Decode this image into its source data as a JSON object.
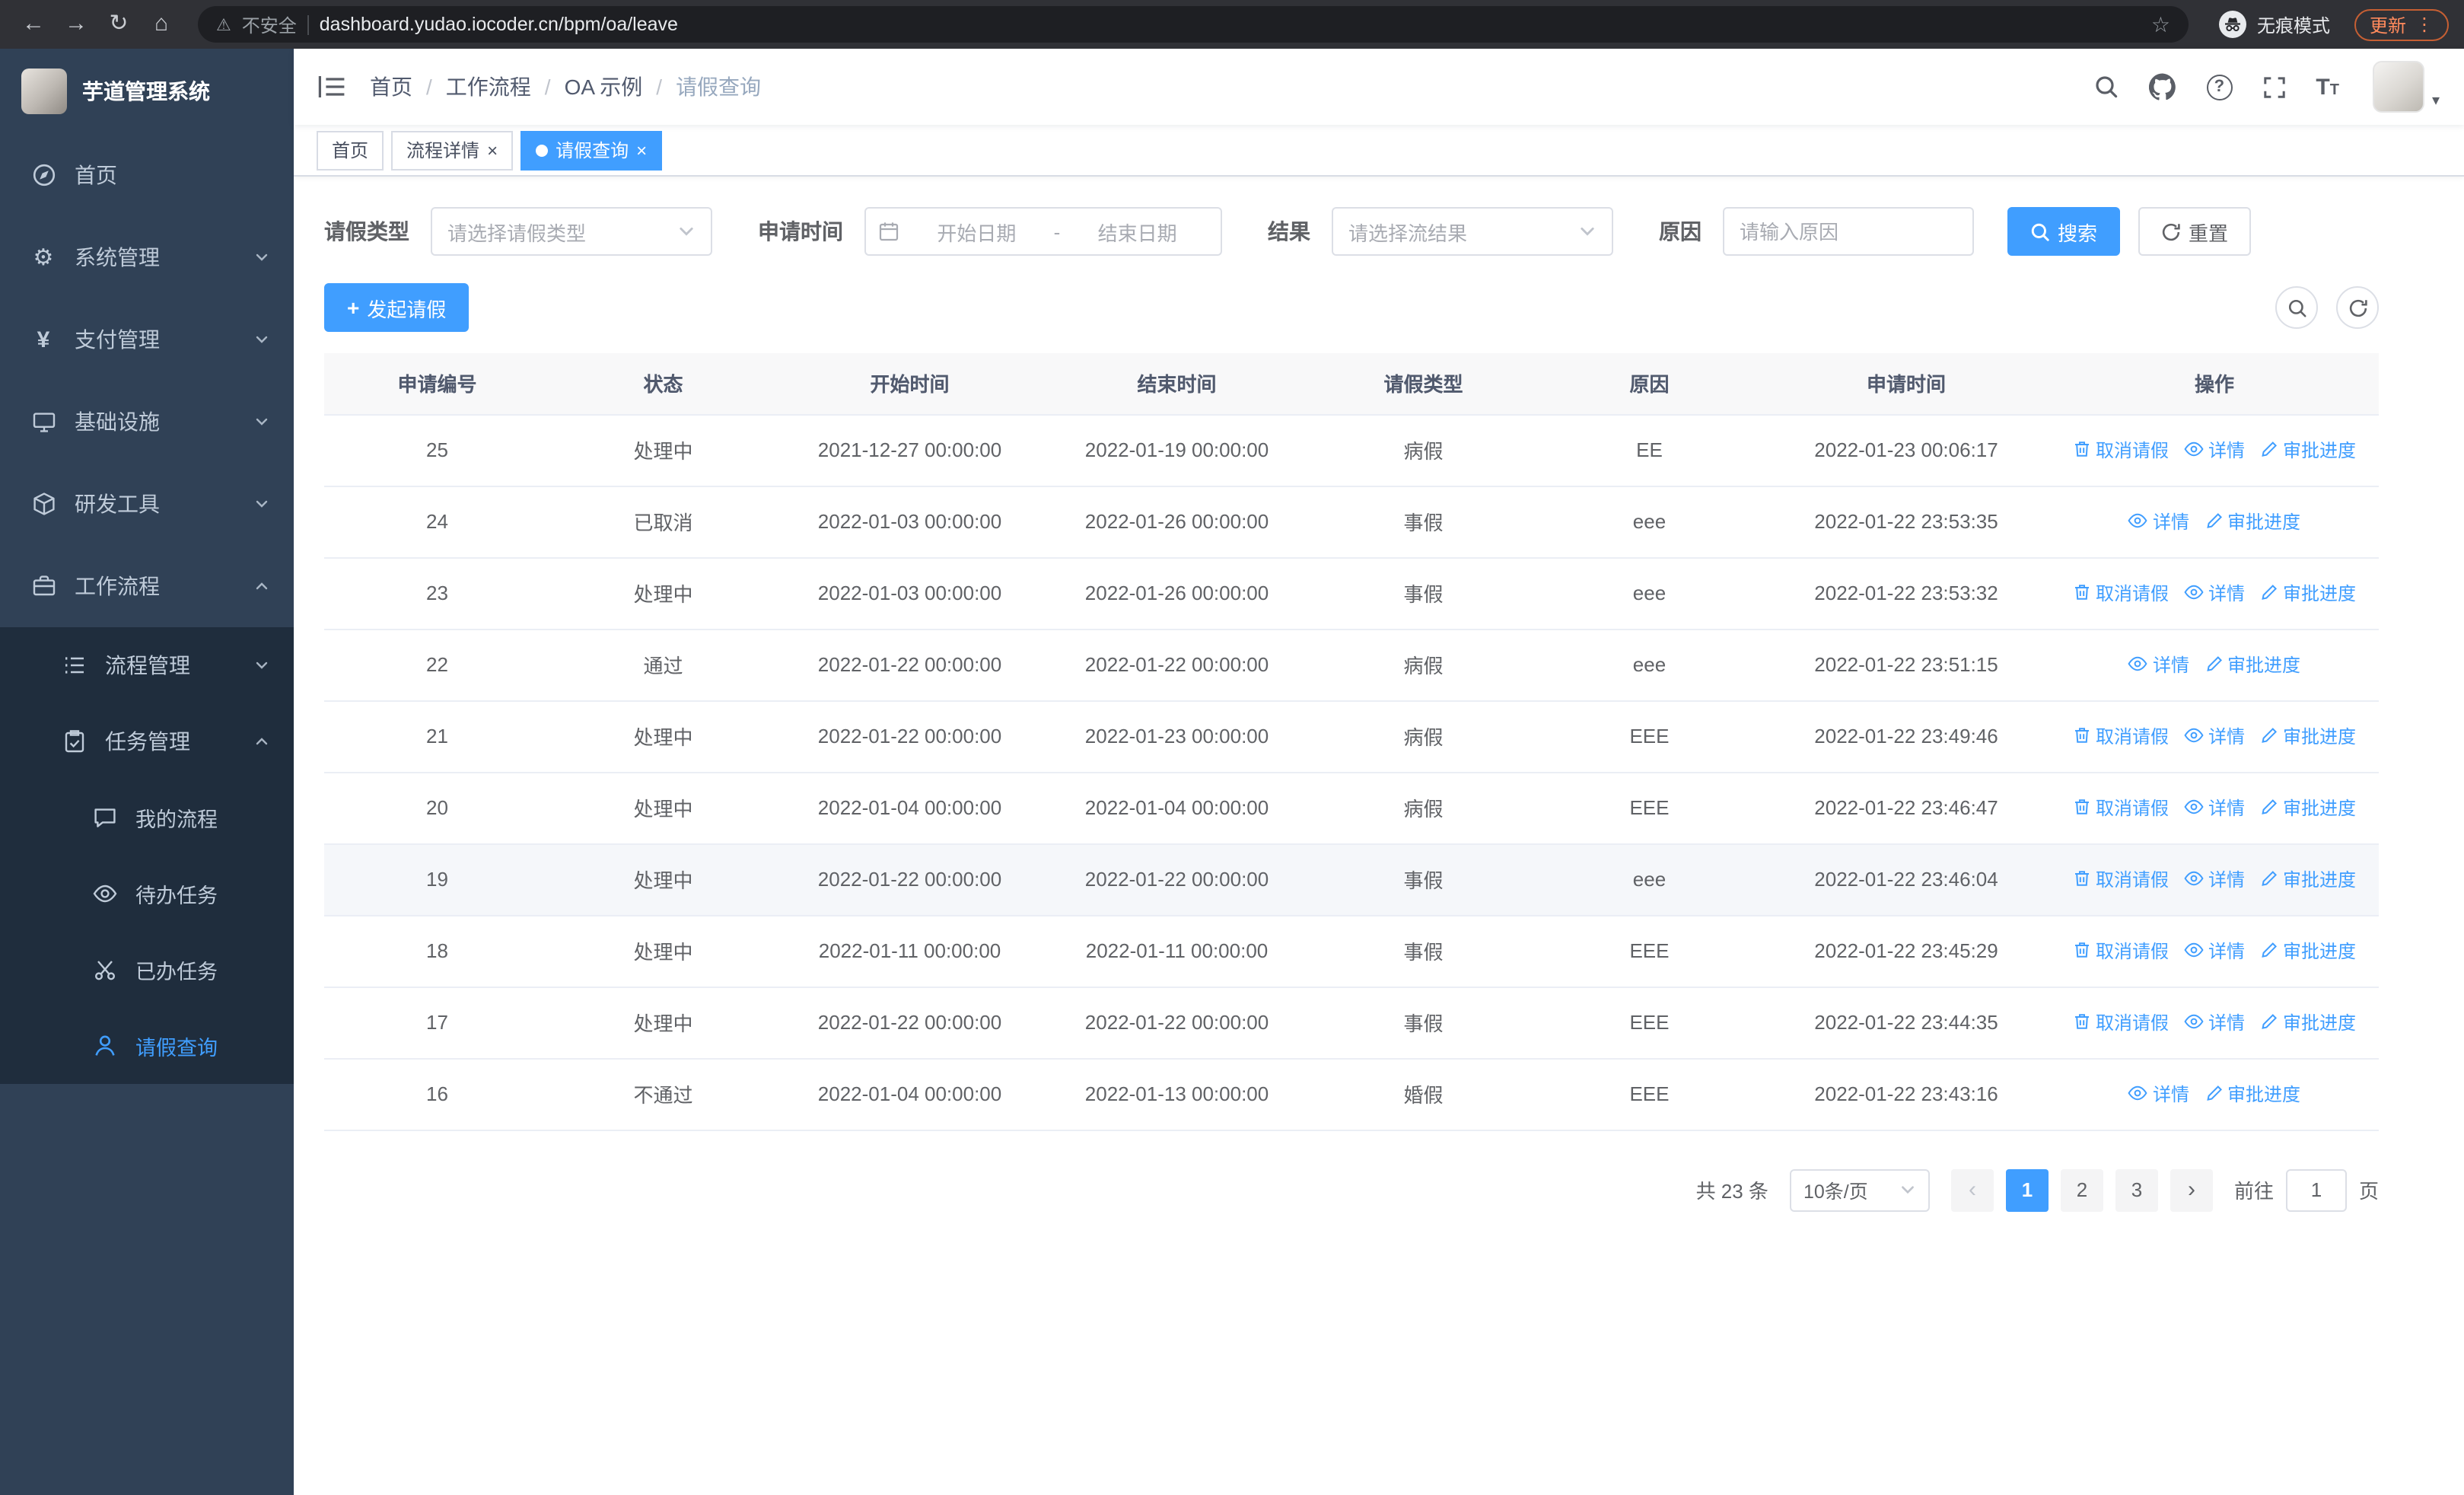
{
  "browser": {
    "security_warning": "不安全",
    "url": "dashboard.yudao.iocoder.cn/bpm/oa/leave",
    "incognito_label": "无痕模式",
    "update_label": "更新"
  },
  "icons": {
    "back": "←",
    "forward": "→",
    "reload": "↻",
    "home": "⌂",
    "warning": "⚠",
    "star": "☆",
    "more": "⋮",
    "close": "×",
    "caret_down": "▾",
    "plus": "+",
    "prev": "‹",
    "next": "›",
    "question": "?",
    "gear": "⚙",
    "yen": "¥",
    "text_size_large": "T",
    "text_size_small": "T"
  },
  "sidebar": {
    "logo_title": "芋道管理系统",
    "items": [
      {
        "label": "首页"
      },
      {
        "label": "系统管理"
      },
      {
        "label": "支付管理"
      },
      {
        "label": "基础设施"
      },
      {
        "label": "研发工具"
      },
      {
        "label": "工作流程"
      },
      {
        "label": "流程管理"
      },
      {
        "label": "任务管理"
      },
      {
        "label": "我的流程"
      },
      {
        "label": "待办任务"
      },
      {
        "label": "已办任务"
      },
      {
        "label": "请假查询"
      }
    ]
  },
  "header": {
    "breadcrumb": [
      "首页",
      "工作流程",
      "OA 示例",
      "请假查询"
    ],
    "breadcrumb_separator": "/"
  },
  "tabs": [
    {
      "label": "首页",
      "closable": false,
      "active": false
    },
    {
      "label": "流程详情",
      "closable": true,
      "active": false
    },
    {
      "label": "请假查询",
      "closable": true,
      "active": true
    }
  ],
  "filters": {
    "leave_type_label": "请假类型",
    "leave_type_placeholder": "请选择请假类型",
    "apply_time_label": "申请时间",
    "start_date_placeholder": "开始日期",
    "date_separator": "-",
    "end_date_placeholder": "结束日期",
    "result_label": "结果",
    "result_placeholder": "请选择流结果",
    "reason_label": "原因",
    "reason_placeholder": "请输入原因",
    "search_button": "搜索",
    "reset_button": "重置"
  },
  "toolbar": {
    "create_button": "发起请假"
  },
  "table": {
    "columns": [
      "申请编号",
      "状态",
      "开始时间",
      "结束时间",
      "请假类型",
      "原因",
      "申请时间",
      "操作"
    ],
    "action_defs": {
      "cancel": {
        "label": "取消请假",
        "icon": "delete-icon"
      },
      "detail": {
        "label": "详情",
        "icon": "view-icon"
      },
      "progress": {
        "label": "审批进度",
        "icon": "edit-icon"
      }
    },
    "rows": [
      {
        "id": "25",
        "status": "处理中",
        "start": "2021-12-27 00:00:00",
        "end": "2022-01-19 00:00:00",
        "type": "病假",
        "reason": "EE",
        "apply_time": "2022-01-23 00:06:17",
        "actions": [
          "cancel",
          "detail",
          "progress"
        ]
      },
      {
        "id": "24",
        "status": "已取消",
        "start": "2022-01-03 00:00:00",
        "end": "2022-01-26 00:00:00",
        "type": "事假",
        "reason": "eee",
        "apply_time": "2022-01-22 23:53:35",
        "actions": [
          "detail",
          "progress"
        ]
      },
      {
        "id": "23",
        "status": "处理中",
        "start": "2022-01-03 00:00:00",
        "end": "2022-01-26 00:00:00",
        "type": "事假",
        "reason": "eee",
        "apply_time": "2022-01-22 23:53:32",
        "actions": [
          "cancel",
          "detail",
          "progress"
        ]
      },
      {
        "id": "22",
        "status": "通过",
        "start": "2022-01-22 00:00:00",
        "end": "2022-01-22 00:00:00",
        "type": "病假",
        "reason": "eee",
        "apply_time": "2022-01-22 23:51:15",
        "actions": [
          "detail",
          "progress"
        ]
      },
      {
        "id": "21",
        "status": "处理中",
        "start": "2022-01-22 00:00:00",
        "end": "2022-01-23 00:00:00",
        "type": "病假",
        "reason": "EEE",
        "apply_time": "2022-01-22 23:49:46",
        "actions": [
          "cancel",
          "detail",
          "progress"
        ]
      },
      {
        "id": "20",
        "status": "处理中",
        "start": "2022-01-04 00:00:00",
        "end": "2022-01-04 00:00:00",
        "type": "病假",
        "reason": "EEE",
        "apply_time": "2022-01-22 23:46:47",
        "actions": [
          "cancel",
          "detail",
          "progress"
        ]
      },
      {
        "id": "19",
        "status": "处理中",
        "start": "2022-01-22 00:00:00",
        "end": "2022-01-22 00:00:00",
        "type": "事假",
        "reason": "eee",
        "apply_time": "2022-01-22 23:46:04",
        "actions": [
          "cancel",
          "detail",
          "progress"
        ],
        "highlighted": true
      },
      {
        "id": "18",
        "status": "处理中",
        "start": "2022-01-11 00:00:00",
        "end": "2022-01-11 00:00:00",
        "type": "事假",
        "reason": "EEE",
        "apply_time": "2022-01-22 23:45:29",
        "actions": [
          "cancel",
          "detail",
          "progress"
        ]
      },
      {
        "id": "17",
        "status": "处理中",
        "start": "2022-01-22 00:00:00",
        "end": "2022-01-22 00:00:00",
        "type": "事假",
        "reason": "EEE",
        "apply_time": "2022-01-22 23:44:35",
        "actions": [
          "cancel",
          "detail",
          "progress"
        ]
      },
      {
        "id": "16",
        "status": "不通过",
        "start": "2022-01-04 00:00:00",
        "end": "2022-01-13 00:00:00",
        "type": "婚假",
        "reason": "EEE",
        "apply_time": "2022-01-22 23:43:16",
        "actions": [
          "detail",
          "progress"
        ]
      }
    ]
  },
  "pagination": {
    "total_text": "共 23 条",
    "page_size": "10条/页",
    "pages": [
      "1",
      "2",
      "3"
    ],
    "active_page": "1",
    "goto_prefix": "前往",
    "goto_value": "1",
    "goto_suffix": "页"
  }
}
